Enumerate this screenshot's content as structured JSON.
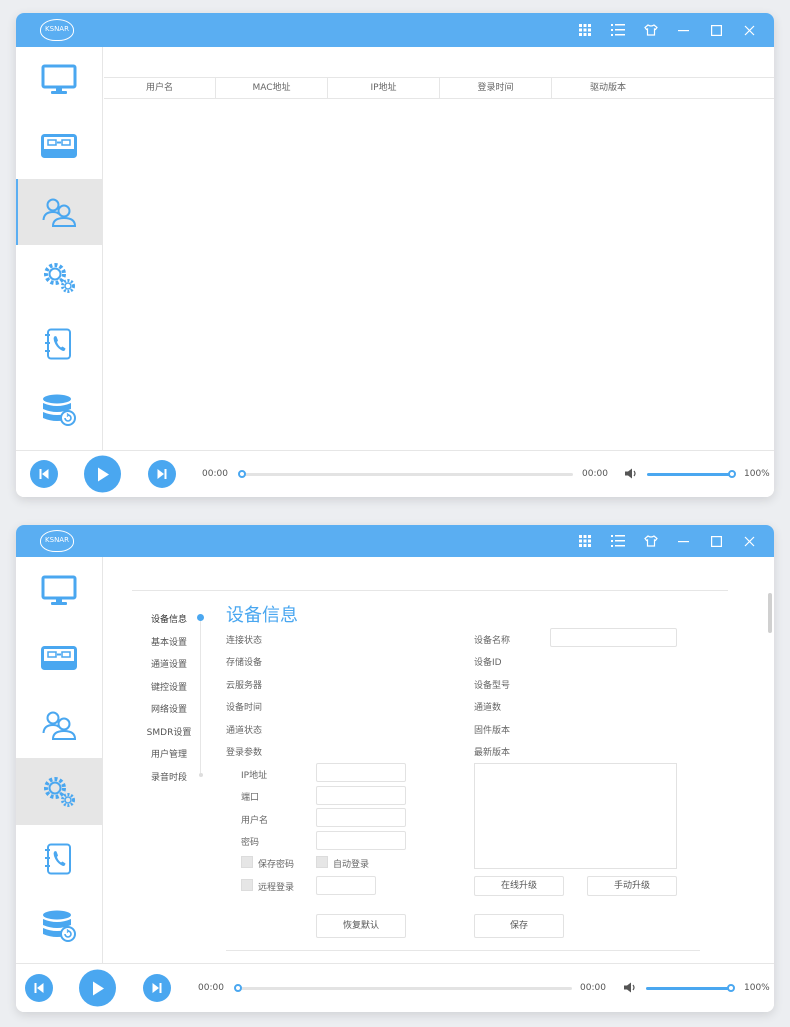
{
  "app": {
    "logo_text": "KSNAR",
    "title_controls": [
      "grid-icon",
      "list-icon",
      "shirt-icon",
      "minimize-icon",
      "maximize-icon",
      "close-icon"
    ]
  },
  "sidebar": {
    "items": [
      {
        "name": "monitor"
      },
      {
        "name": "recorder"
      },
      {
        "name": "users"
      },
      {
        "name": "settings"
      },
      {
        "name": "phonebook"
      },
      {
        "name": "database"
      }
    ]
  },
  "window1": {
    "active_nav": "users",
    "table": {
      "columns": [
        "用户名",
        "MAC地址",
        "IP地址",
        "登录时间",
        "驱动版本"
      ],
      "rows": []
    }
  },
  "player": {
    "time_start": "00:00",
    "time_end": "00:00",
    "progress": 0,
    "volume": 100,
    "volume_label": "100%"
  },
  "window2": {
    "active_nav": "settings",
    "subnav": [
      "设备信息",
      "基本设置",
      "通道设置",
      "键控设置",
      "网络设置",
      "SMDR设置",
      "用户管理",
      "录音时段"
    ],
    "active_subnav": "设备信息",
    "section_title": "设备信息",
    "left_labels": {
      "connection_status": "连接状态",
      "storage_device": "存储设备",
      "cloud_server": "云服务器",
      "device_time": "设备时间",
      "channel_status": "通道状态",
      "login_params": "登录参数"
    },
    "login_fields": {
      "ip": "IP地址",
      "port": "端口",
      "username": "用户名",
      "password": "密码"
    },
    "checkboxes": {
      "save_password": "保存密码",
      "auto_login": "自动登录",
      "remote_login": "远程登录"
    },
    "right_labels": {
      "device_name": "设备名称",
      "device_id": "设备ID",
      "device_model": "设备型号",
      "channel_count": "通道数",
      "firmware_version": "固件版本",
      "latest_version": "最新版本"
    },
    "buttons": {
      "online_upgrade": "在线升级",
      "manual_upgrade": "手动升级",
      "restore_default": "恢复默认",
      "save": "保存"
    }
  }
}
